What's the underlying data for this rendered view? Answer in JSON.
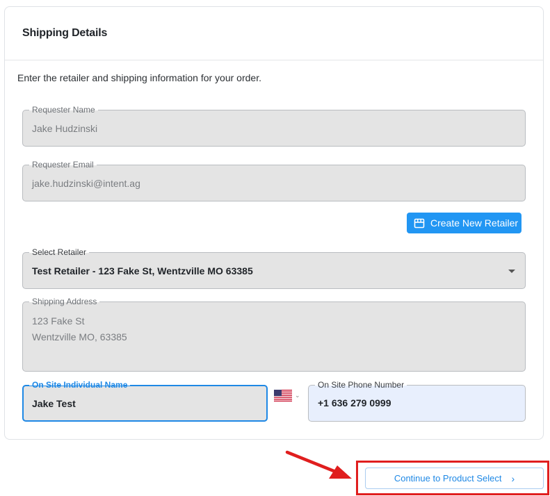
{
  "card": {
    "title": "Shipping Details",
    "intro": "Enter the retailer and shipping information for your order."
  },
  "fields": {
    "requester_name": {
      "label": "Requester Name",
      "value": "Jake Hudzinski"
    },
    "requester_email": {
      "label": "Requester Email",
      "value": "jake.hudzinski@intent.ag"
    },
    "select_retailer": {
      "label": "Select Retailer",
      "value": "Test Retailer - 123 Fake St, Wentzville MO 63385"
    },
    "shipping_address": {
      "label": "Shipping Address",
      "line1": "123 Fake St",
      "line2": "Wentzville MO, 63385"
    },
    "on_site_name": {
      "label": "On Site Individual Name",
      "value": "Jake Test"
    },
    "on_site_phone": {
      "label": "On Site Phone Number",
      "value": "+1 636 279 0999",
      "country_icon": "us-flag-icon"
    }
  },
  "buttons": {
    "create_retailer": {
      "label": "Create New Retailer",
      "icon": "store-icon"
    },
    "continue": {
      "label": "Continue to Product Select",
      "icon": "chevron-right-icon"
    }
  },
  "colors": {
    "accent": "#2196f3",
    "focus": "#1e88e5",
    "annotation": "#e01e1e",
    "disabled_field_bg": "#e4e4e4",
    "phone_field_bg": "#e8effd"
  }
}
